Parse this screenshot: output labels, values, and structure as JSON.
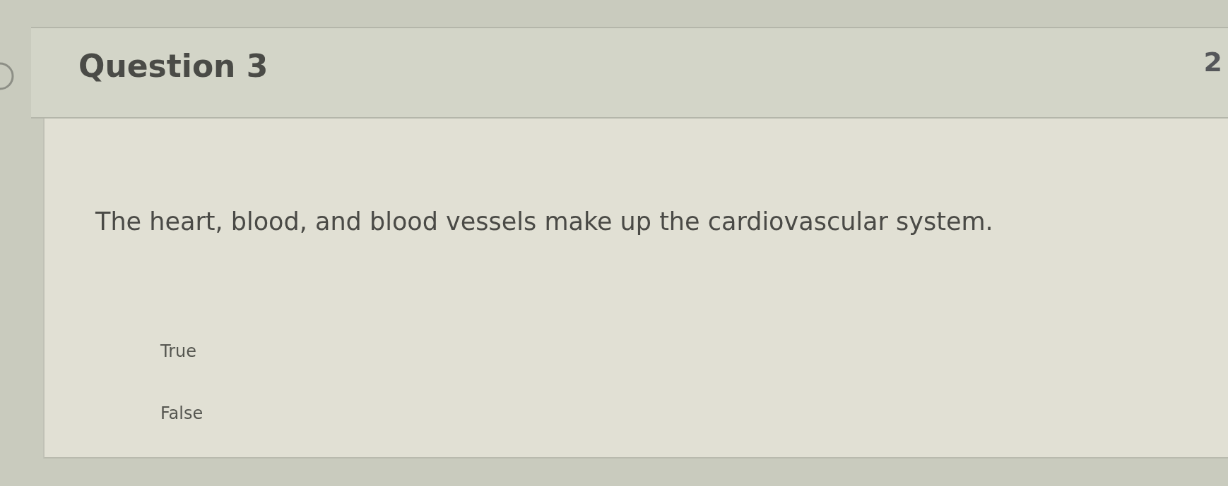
{
  "question": {
    "title": "Question 3",
    "points": "2",
    "text": "The heart, blood, and blood vessels make up the cardiovascular system.",
    "answers": [
      {
        "label": "True"
      },
      {
        "label": "False"
      }
    ]
  }
}
